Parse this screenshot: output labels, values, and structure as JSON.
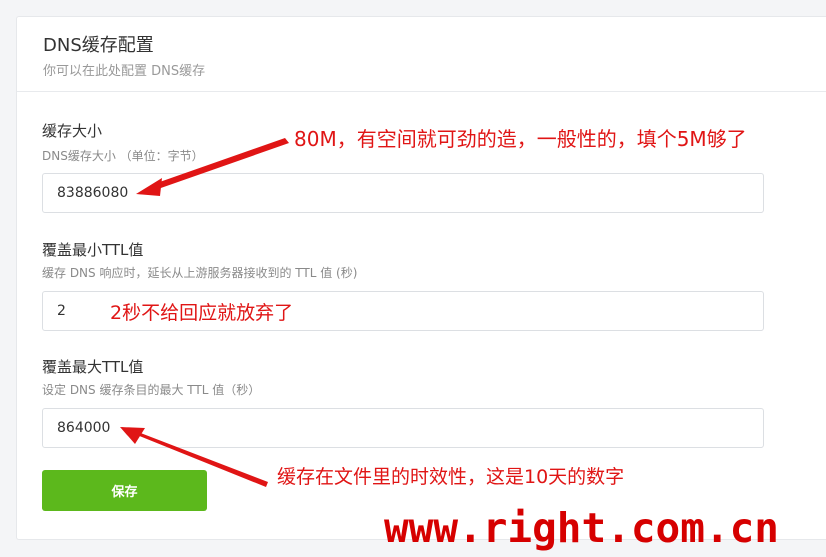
{
  "card": {
    "title": "DNS缓存配置",
    "subtitle": "你可以在此处配置 DNS缓存"
  },
  "fields": [
    {
      "label": "缓存大小",
      "help": "DNS缓存大小 （单位：字节）",
      "value": "83886080"
    },
    {
      "label": "覆盖最小TTL值",
      "help": "缓存 DNS 响应时，延长从上游服务器接收到的 TTL 值 (秒)",
      "value": "2"
    },
    {
      "label": "覆盖最大TTL值",
      "help": "设定 DNS 缓存条目的最大 TTL 值（秒）",
      "value": "864000"
    }
  ],
  "save_button": {
    "label": "保存"
  },
  "annotations": {
    "cache_size": "80M，有空间就可劲的造，一般性的，填个5M够了",
    "min_ttl": "2秒不给回应就放弃了",
    "max_ttl": "缓存在文件里的时效性，这是10天的数字"
  },
  "watermark": "www.right.com.cn",
  "colors": {
    "annotation": "#e01515",
    "save_button": "#5cb81c",
    "watermark": "#d60000"
  }
}
